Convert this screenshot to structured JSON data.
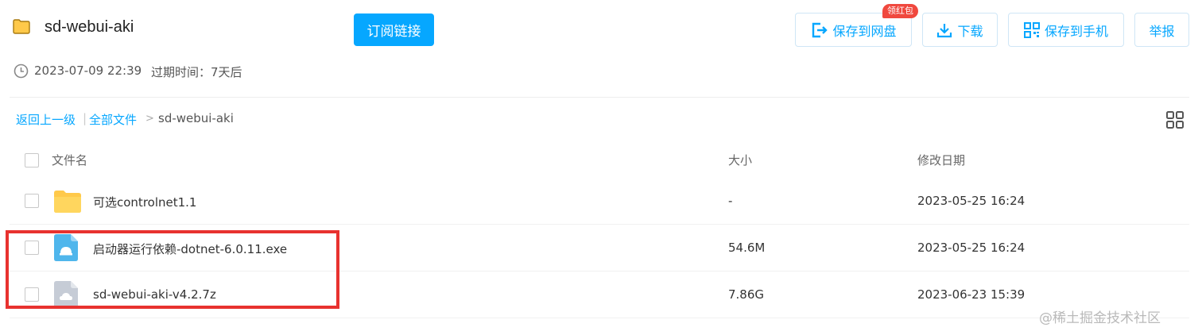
{
  "header": {
    "title": "sd-webui-aki",
    "subscribe_label": "订阅链接",
    "save_netdisk_label": "保存到网盘",
    "save_netdisk_badge": "领红包",
    "download_label": "下载",
    "save_phone_label": "保存到手机",
    "report_label": "举报"
  },
  "meta": {
    "date": "2023-07-09 22:39",
    "expire": "过期时间：7天后"
  },
  "breadcrumb": {
    "back": "返回上一级",
    "separator": "|",
    "all_files": "全部文件",
    "arrow": ">",
    "current": "sd-webui-aki"
  },
  "table": {
    "columns": {
      "name": "文件名",
      "size": "大小",
      "modified": "修改日期"
    },
    "rows": [
      {
        "name": "可选controlnet1.1",
        "size": "-",
        "modified": "2023-05-25 16:24",
        "icon": "folder-icon"
      },
      {
        "name": "启动器运行依赖-dotnet-6.0.11.exe",
        "size": "54.6M",
        "modified": "2023-05-25 16:24",
        "icon": "exe-file-icon"
      },
      {
        "name": "sd-webui-aki-v4.2.7z",
        "size": "7.86G",
        "modified": "2023-06-23 15:39",
        "icon": "archive-file-icon"
      }
    ]
  },
  "watermark": "@稀土掘金技术社区",
  "colors": {
    "accent": "#06a7ff",
    "badge": "#f0483e",
    "highlight": "#e8322f",
    "folder": "#ffc94a"
  }
}
